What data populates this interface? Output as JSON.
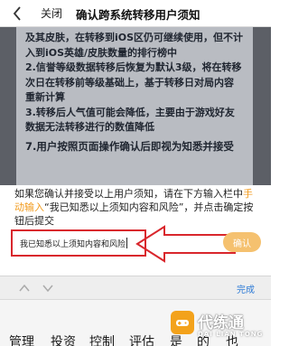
{
  "nav": {
    "close_label": "关闭",
    "title": "确认跨系统转移用户须知"
  },
  "notice": {
    "lines": [
      "及其皮肤，在转移到iOS区仍可继续使用，但不计",
      "入到iOS英雄/皮肤数量的排行榜中",
      "2.信誉等级数据转移后恢复为默认3级，将在转移",
      "次日在转移前等级基础上，基于转移日对局内容",
      "重新计算",
      "3.转移后人气值可能会降低，主要由于游戏好友",
      "数据无法转移进行的数值降低"
    ],
    "heading": "7.用户按照页面操作确认后即视为知悉并接受"
  },
  "prompt": {
    "part1": "如果您确认并接受以上用户须知，请在下方输入栏中",
    "link": "手动输入",
    "part2": "“我已知悉以上须知内容和风险”，并点击确定按钮后提交"
  },
  "input": {
    "value": "我已知悉以上须知内容和风险"
  },
  "confirm_button": "确认",
  "keyboard": {
    "done_label": "完成",
    "candidates": [
      "管理",
      "投资",
      "控制",
      "评估",
      "是",
      "的",
      "也"
    ]
  },
  "watermark": {
    "title": "代练通",
    "subtitle": "DAI LIAN TONG"
  }
}
